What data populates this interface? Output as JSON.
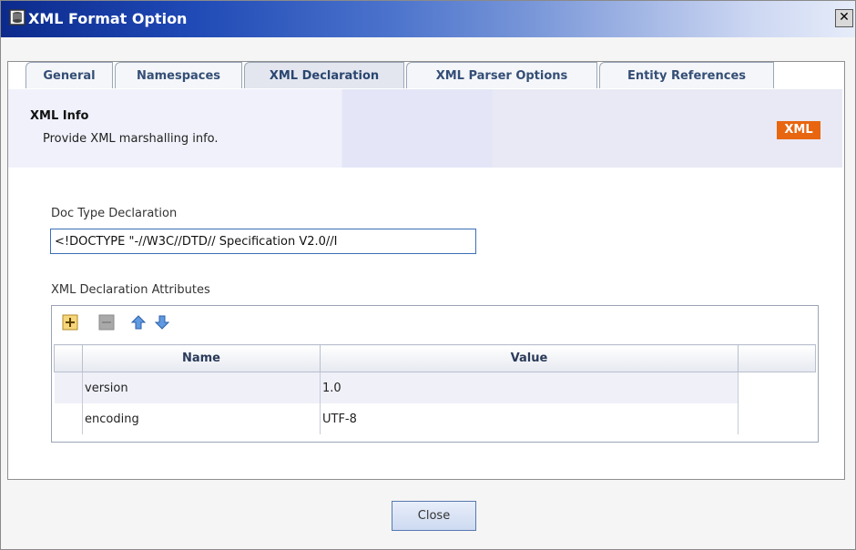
{
  "window": {
    "title": "XML Format Option",
    "close_glyph": "✕"
  },
  "tabs": [
    {
      "label": "General",
      "active": false
    },
    {
      "label": "Namespaces",
      "active": false
    },
    {
      "label": "XML Declaration",
      "active": true
    },
    {
      "label": "XML Parser Options",
      "active": false
    },
    {
      "label": "Entity References",
      "active": false
    }
  ],
  "banner": {
    "title": "XML Info",
    "description": "Provide XML marshalling info.",
    "badge": "XML"
  },
  "doctype": {
    "label": "Doc Type Declaration",
    "value": "<!DOCTYPE \"-//W3C//DTD// Specification V2.0//I"
  },
  "attributes": {
    "label": "XML Declaration Attributes",
    "toolbar": {
      "icons": [
        "add-icon",
        "remove-icon",
        "move-up-icon",
        "move-down-icon"
      ]
    },
    "columns": [
      "Name",
      "Value"
    ],
    "rows": [
      {
        "name": "version",
        "value": "1.0"
      },
      {
        "name": "encoding",
        "value": "UTF-8"
      }
    ]
  },
  "footer": {
    "close_label": "Close"
  },
  "colors": {
    "badge": "#e8660f",
    "title_bar_start": "#0c2a8c",
    "tab_text": "#344e76"
  }
}
